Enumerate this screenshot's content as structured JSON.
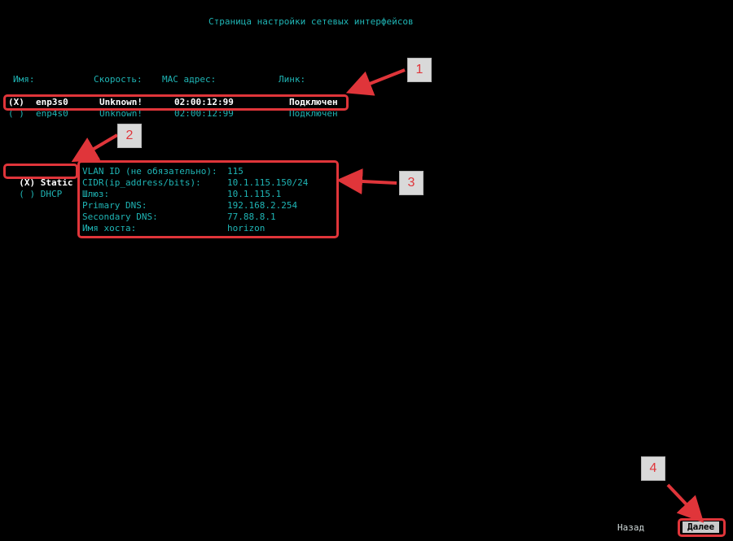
{
  "title": "Страница настройки сетевых интерфейсов",
  "headers": {
    "name": "Имя:",
    "speed": "Скорость:",
    "mac": "MAC адрес:",
    "link": "Линк:"
  },
  "interfaces": [
    {
      "radio": "(X)",
      "name": "enp3s0",
      "speed": "Unknown!",
      "mac": "02:00:12:99",
      "link": "Подключен"
    },
    {
      "radio": "( )",
      "name": "enp4s0",
      "speed": "Unknown!",
      "mac": "02:00:12:99",
      "link": "Подключен"
    }
  ],
  "modes": [
    {
      "radio": "(X)",
      "label": "Static"
    },
    {
      "radio": "( )",
      "label": "DHCP"
    }
  ],
  "fields": [
    {
      "label": "VLAN ID (не обязательно):",
      "value": "115"
    },
    {
      "label": "CIDR(ip_address/bits):",
      "value": "10.1.115.150/24"
    },
    {
      "label": "Шлюз:",
      "value": "10.1.115.1"
    },
    {
      "label": "Primary DNS:",
      "value": "192.168.2.254"
    },
    {
      "label": "Secondary DNS:",
      "value": "77.88.8.1"
    },
    {
      "label": "Имя хоста:",
      "value": "horizon"
    }
  ],
  "markers": [
    "1",
    "2",
    "3",
    "4"
  ],
  "buttons": {
    "back": "Назад",
    "next": "Далее"
  },
  "colors": {
    "text": "#1fb5b5",
    "highlight": "#ffffff",
    "annotation": "#e0353a",
    "background": "#000000"
  }
}
